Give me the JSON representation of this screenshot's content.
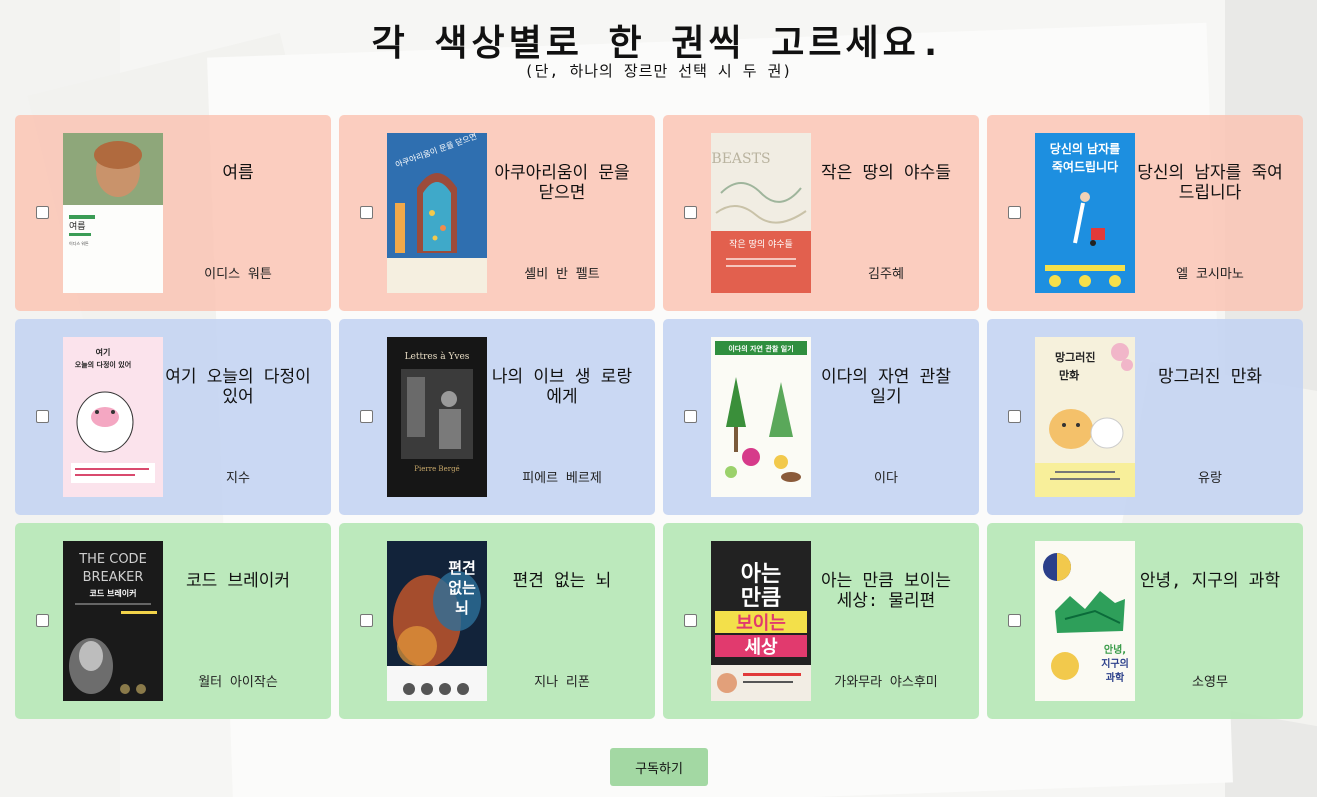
{
  "header": {
    "title": "각 색상별로 한 권씩 고르세요.",
    "subtitle": "(단, 하나의 장르만 선택 시 두 권)"
  },
  "colors": {
    "red": "#fac4b4",
    "blue": "#c4d4f2",
    "green": "#b8e8b8",
    "button": "#a3d8a3"
  },
  "books": [
    {
      "title": "여름",
      "author": "이디스 워튼",
      "group": "red",
      "cover_lines": [
        "여름",
        "이디스 워튼"
      ]
    },
    {
      "title": "아쿠아리움이 문을 닫으면",
      "author": "셸비 반 펠트",
      "group": "red",
      "cover_lines": [
        "아쿠아리움이 문을 닫으면"
      ]
    },
    {
      "title": "작은 땅의 야수들",
      "author": "김주혜",
      "group": "red",
      "cover_lines": [
        "BEASTS",
        "작은 땅의 야수들"
      ]
    },
    {
      "title": "당신의 남자를 죽여 드립니다",
      "author": "엘 코시마노",
      "group": "red",
      "cover_lines": [
        "당신의 남자를",
        "죽여드립니다"
      ]
    },
    {
      "title": "여기 오늘의 다정이 있어",
      "author": "지수",
      "group": "blue",
      "cover_lines": [
        "여기",
        "오늘의 다정이 있어"
      ]
    },
    {
      "title": "나의 이브 생 로랑에게",
      "author": "피에르 베르제",
      "group": "blue",
      "cover_lines": [
        "Lettres à Yves",
        "Pierre Bergé"
      ]
    },
    {
      "title": "이다의 자연 관찰 일기",
      "author": "이다",
      "group": "blue",
      "cover_lines": [
        "이다의 자연 관찰 일기"
      ]
    },
    {
      "title": "망그러진 만화",
      "author": "유랑",
      "group": "blue",
      "cover_lines": [
        "망그러진",
        "만화"
      ]
    },
    {
      "title": "코드 브레이커",
      "author": "월터 아이작슨",
      "group": "green",
      "cover_lines": [
        "THE CODE",
        "BREAKER",
        "코드 브레이커"
      ]
    },
    {
      "title": "편견 없는 뇌",
      "author": "지나 리폰",
      "group": "green",
      "cover_lines": [
        "편견",
        "없는",
        "뇌"
      ]
    },
    {
      "title": "아는 만큼 보이는 세상: 물리편",
      "author": "가와무라 야스후미",
      "group": "green",
      "cover_lines": [
        "아는",
        "만큼",
        "보이는",
        "세상"
      ]
    },
    {
      "title": "안녕, 지구의 과학",
      "author": "소영무",
      "group": "green",
      "cover_lines": [
        "안녕,",
        "지구의",
        "과학"
      ]
    }
  ],
  "actions": {
    "subscribe_label": "구독하기"
  }
}
